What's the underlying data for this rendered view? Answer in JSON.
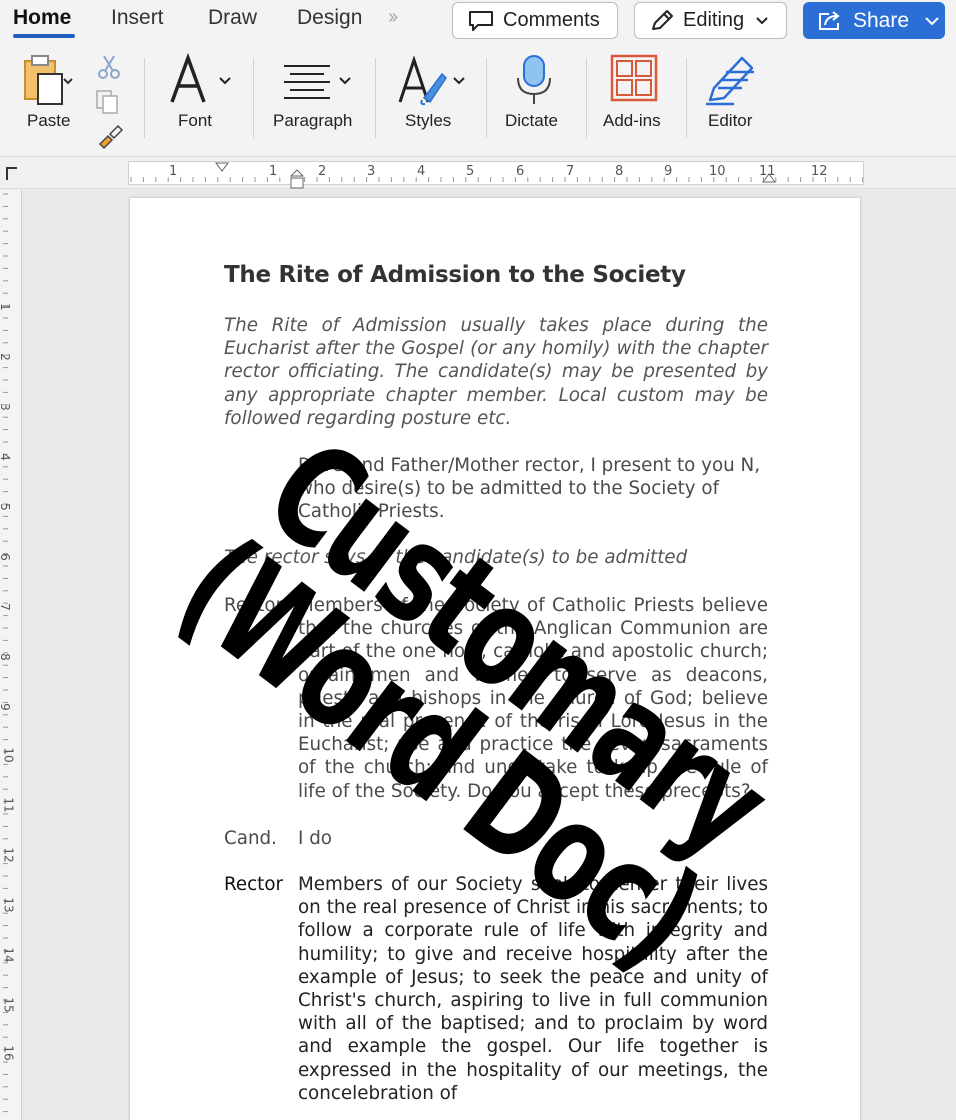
{
  "tabs": [
    {
      "label": "Home",
      "active": true
    },
    {
      "label": "Insert",
      "active": false
    },
    {
      "label": "Draw",
      "active": false
    },
    {
      "label": "Design",
      "active": false
    }
  ],
  "more_tabs_icon": "double-chevron-right",
  "buttons": {
    "comments_label": "Comments",
    "editing_label": "Editing",
    "share_label": "Share"
  },
  "ribbon": {
    "paste_label": "Paste",
    "font_label": "Font",
    "paragraph_label": "Paragraph",
    "styles_label": "Styles",
    "dictate_label": "Dictate",
    "addins_label": "Add-ins",
    "editor_label": "Editor"
  },
  "ruler": {
    "numbers": [
      "1",
      "1",
      "2",
      "3",
      "4",
      "5",
      "6",
      "7",
      "8",
      "9",
      "10",
      "11",
      "12"
    ]
  },
  "vertical_ruler": {
    "numbers": [
      "1",
      "2",
      "3",
      "4",
      "5",
      "6",
      "7",
      "8",
      "9",
      "10",
      "11",
      "12",
      "13",
      "14",
      "15",
      "16"
    ]
  },
  "document": {
    "title": "The Rite of Admission to the Society",
    "intro": "The Rite of Admission usually takes place during the Eucharist after the Gospel (or any homily) with the chapter rector officiating. The candidate(s) may be presented by any appropriate chapter member. Local custom may be followed regarding posture etc.",
    "presentation": "Reverend Father/Mother rector, I present to you N, who desire(s) to be admitted to the Society of Catholic Priests.",
    "rubric": "The rector says to the candidate(s) to be admitted",
    "rector_question_speaker": "Rector",
    "rector_question": "Members of the Society of Catholic Priests believe that the churches of the Anglican Communion are part of the one holy, catholic and apostolic church; ordain men and women to serve as deacons, priests and bishops in the church of God; believe in the real presence of the risen Lord Jesus in the Eucharist; use and practice the seven sacraments of the church; and undertake to keep the rule of life of the Society. Do you accept these precepts?",
    "cand_speaker": "Cand.",
    "cand_answer": "I do",
    "rector_speaker": "Rector",
    "rector_statement": "Members of our Society seek to center their lives on the real presence of Christ in his sacraments; to follow a corporate rule of life with integrity and humility; to give and receive hospitality after the example of Jesus; to seek the peace and unity of Christ's church, aspiring to live in full communion with all of the baptised; and to proclaim by word and example the gospel. Our life together is expressed in the hospitality of our meetings, the concelebration of"
  },
  "overlay": {
    "line1": "Customary",
    "line2": "(Word Doc)"
  },
  "colors": {
    "accent": "#2b6fd6",
    "tab_underline": "#1f5fbf",
    "addins_icon": "#d9583b",
    "editor_icon": "#2b6fd6"
  }
}
